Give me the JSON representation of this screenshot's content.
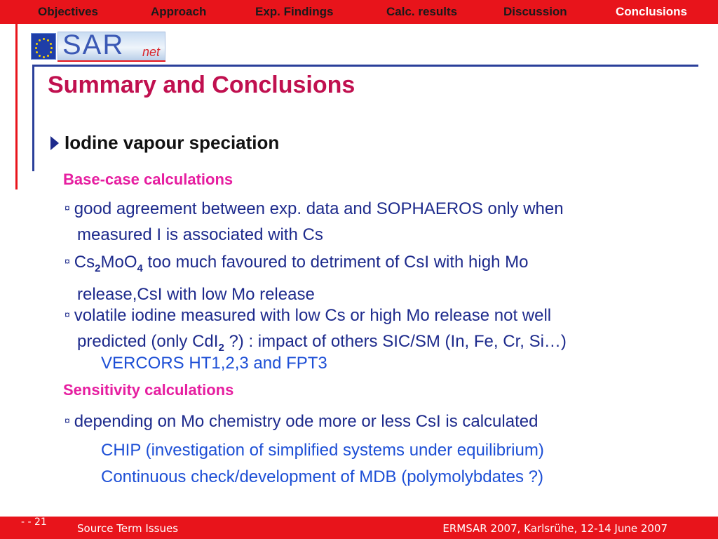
{
  "nav": {
    "items": [
      {
        "label": "Objectives"
      },
      {
        "label": "Approach"
      },
      {
        "label": "Exp. Findings"
      },
      {
        "label": "Calc. results"
      },
      {
        "label": "Discussion"
      },
      {
        "label": "Conclusions",
        "active": true
      }
    ]
  },
  "logo": {
    "text": "SAR",
    "suffix": "net"
  },
  "title": "Summary and Conclusions",
  "section": "Iodine vapour speciation",
  "base_case": {
    "heading": "Base-case calculations",
    "bullet_mark": "¤",
    "b1_line1": "good agreement between exp. data and SOPHAEROS only when",
    "b1_line2": "measured I is associated with Cs",
    "b2_cs": "Cs",
    "b2_cs_sub": "2",
    "b2_moo": "MoO",
    "b2_moo_sub": "4",
    "b2_rest": " too much favoured to detriment of CsI with high Mo",
    "b2_line2": "release,CsI with low Mo release",
    "b3_line1": "volatile iodine measured with low Cs or high Mo release not well",
    "b3_line2a": "predicted (only CdI",
    "b3_sub": "2",
    "b3_line2b": " ?) : impact of others SIC/SM (In, Fe, Cr, Si…)",
    "note": "VERCORS HT1,2,3 and FPT3"
  },
  "sensitivity": {
    "heading": "Sensitivity calculations",
    "b1": "depending on Mo chemistry ode more or less CsI is calculated",
    "note1": "CHIP (investigation of simplified systems under equilibrium)",
    "note2": "Continuous check/development of MDB (polymolybdates ?)"
  },
  "footer": {
    "page": "-  - 21",
    "left": "Source Term Issues",
    "right": "ERMSAR 2007, Karlsrühe, 12-14 June 2007"
  },
  "colors": {
    "accent_red": "#e8141b",
    "title": "#c0104f",
    "subhead": "#e61ea0",
    "body_blue": "#1d2a8c",
    "note_blue": "#1d4fd6"
  }
}
